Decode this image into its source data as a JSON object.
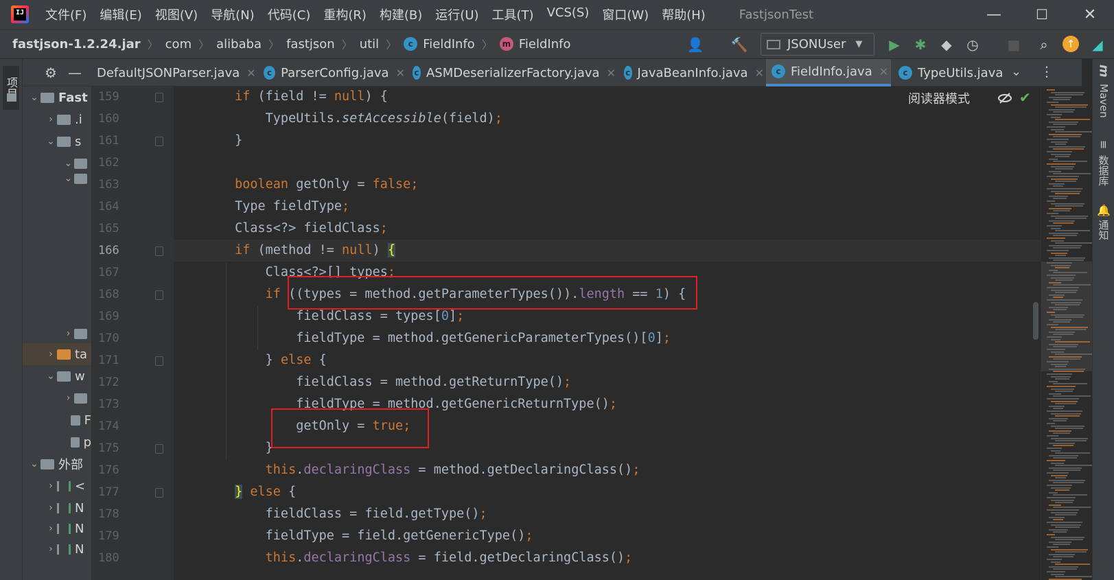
{
  "window": {
    "title": "FastjsonTest",
    "logo_text": "IJ",
    "menu": [
      "文件(F)",
      "编辑(E)",
      "视图(V)",
      "导航(N)",
      "代码(C)",
      "重构(R)",
      "构建(B)",
      "运行(U)",
      "工具(T)",
      "VCS(S)",
      "窗口(W)",
      "帮助(H)"
    ],
    "controls": {
      "minimize": "—",
      "maximize": "☐",
      "close": "✕"
    }
  },
  "breadcrumb": [
    "fastjson-1.2.24.jar",
    "com",
    "alibaba",
    "fastjson",
    "util",
    "FieldInfo",
    "FieldInfo"
  ],
  "toolbar": {
    "run_config": "JSONUser",
    "icons": [
      "user-icon",
      "build-hammer-icon",
      "run-icon",
      "debug-icon",
      "coverage-icon",
      "profile-icon",
      "stop-icon",
      "search-icon",
      "update-icon",
      "toolbox-icon"
    ]
  },
  "tool_windows": {
    "left": "项目",
    "right": [
      "Maven",
      "数据库",
      "通知"
    ]
  },
  "project_tree": [
    {
      "label": "Fast",
      "arrow": "⌄",
      "bold": true
    },
    {
      "label": ".i",
      "arrow": "›"
    },
    {
      "label": "s",
      "arrow": "⌄"
    },
    {
      "label": "",
      "arrow": "⌄"
    },
    {
      "label": "",
      "arrow": "⌄"
    },
    {
      "label": "",
      "arrow": "›"
    },
    {
      "label": "ta",
      "arrow": "›",
      "selected": true
    },
    {
      "label": "w",
      "arrow": "⌄"
    },
    {
      "label": "",
      "arrow": "›"
    },
    {
      "label": "F",
      "arrow": ""
    },
    {
      "label": "p",
      "arrow": ""
    },
    {
      "label": "外部",
      "arrow": "⌄"
    },
    {
      "label": "<",
      "arrow": "›"
    },
    {
      "label": "N",
      "arrow": "›"
    },
    {
      "label": "N",
      "arrow": "›"
    },
    {
      "label": "N",
      "arrow": "›"
    }
  ],
  "tabs": [
    {
      "label": "DefaultJSONParser.java",
      "icon": "none"
    },
    {
      "label": "ParserConfig.java",
      "icon": "class"
    },
    {
      "label": "ASMDeserializerFactory.java",
      "icon": "class"
    },
    {
      "label": "JavaBeanInfo.java",
      "icon": "class"
    },
    {
      "label": "FieldInfo.java",
      "icon": "class",
      "active": true
    },
    {
      "label": "TypeUtils.java",
      "icon": "class"
    }
  ],
  "editor": {
    "reader_mode": "阅读器模式",
    "current_line": 166,
    "line_numbers": [
      "159",
      "160",
      "161",
      "162",
      "163",
      "164",
      "165",
      "166",
      "167",
      "168",
      "169",
      "170",
      "171",
      "172",
      "173",
      "174",
      "175",
      "176",
      "177",
      "178",
      "179",
      "180"
    ],
    "code": [
      "        if (field != null) {",
      "            TypeUtils.setAccessible(field);",
      "        }",
      "",
      "        boolean getOnly = false;",
      "        Type fieldType;",
      "        Class<?> fieldClass;",
      "        if (method != null) {",
      "            Class<?>[] types;",
      "            if ((types = method.getParameterTypes()).length == 1) {",
      "                fieldClass = types[0];",
      "                fieldType = method.getGenericParameterTypes()[0];",
      "            } else {",
      "                fieldClass = method.getReturnType();",
      "                fieldType = method.getGenericReturnType();",
      "                getOnly = true;",
      "            }",
      "            this.declaringClass = method.getDeclaringClass();",
      "        } else {",
      "            fieldClass = field.getType();",
      "            fieldType = field.getGenericType();",
      "            this.declaringClass = field.getDeclaringClass();"
    ]
  },
  "colors": {
    "keyword": "#cc7832",
    "number": "#6897bb",
    "field": "#9876aa",
    "text": "#a9b7c6",
    "highlight_box": "#e02020"
  }
}
